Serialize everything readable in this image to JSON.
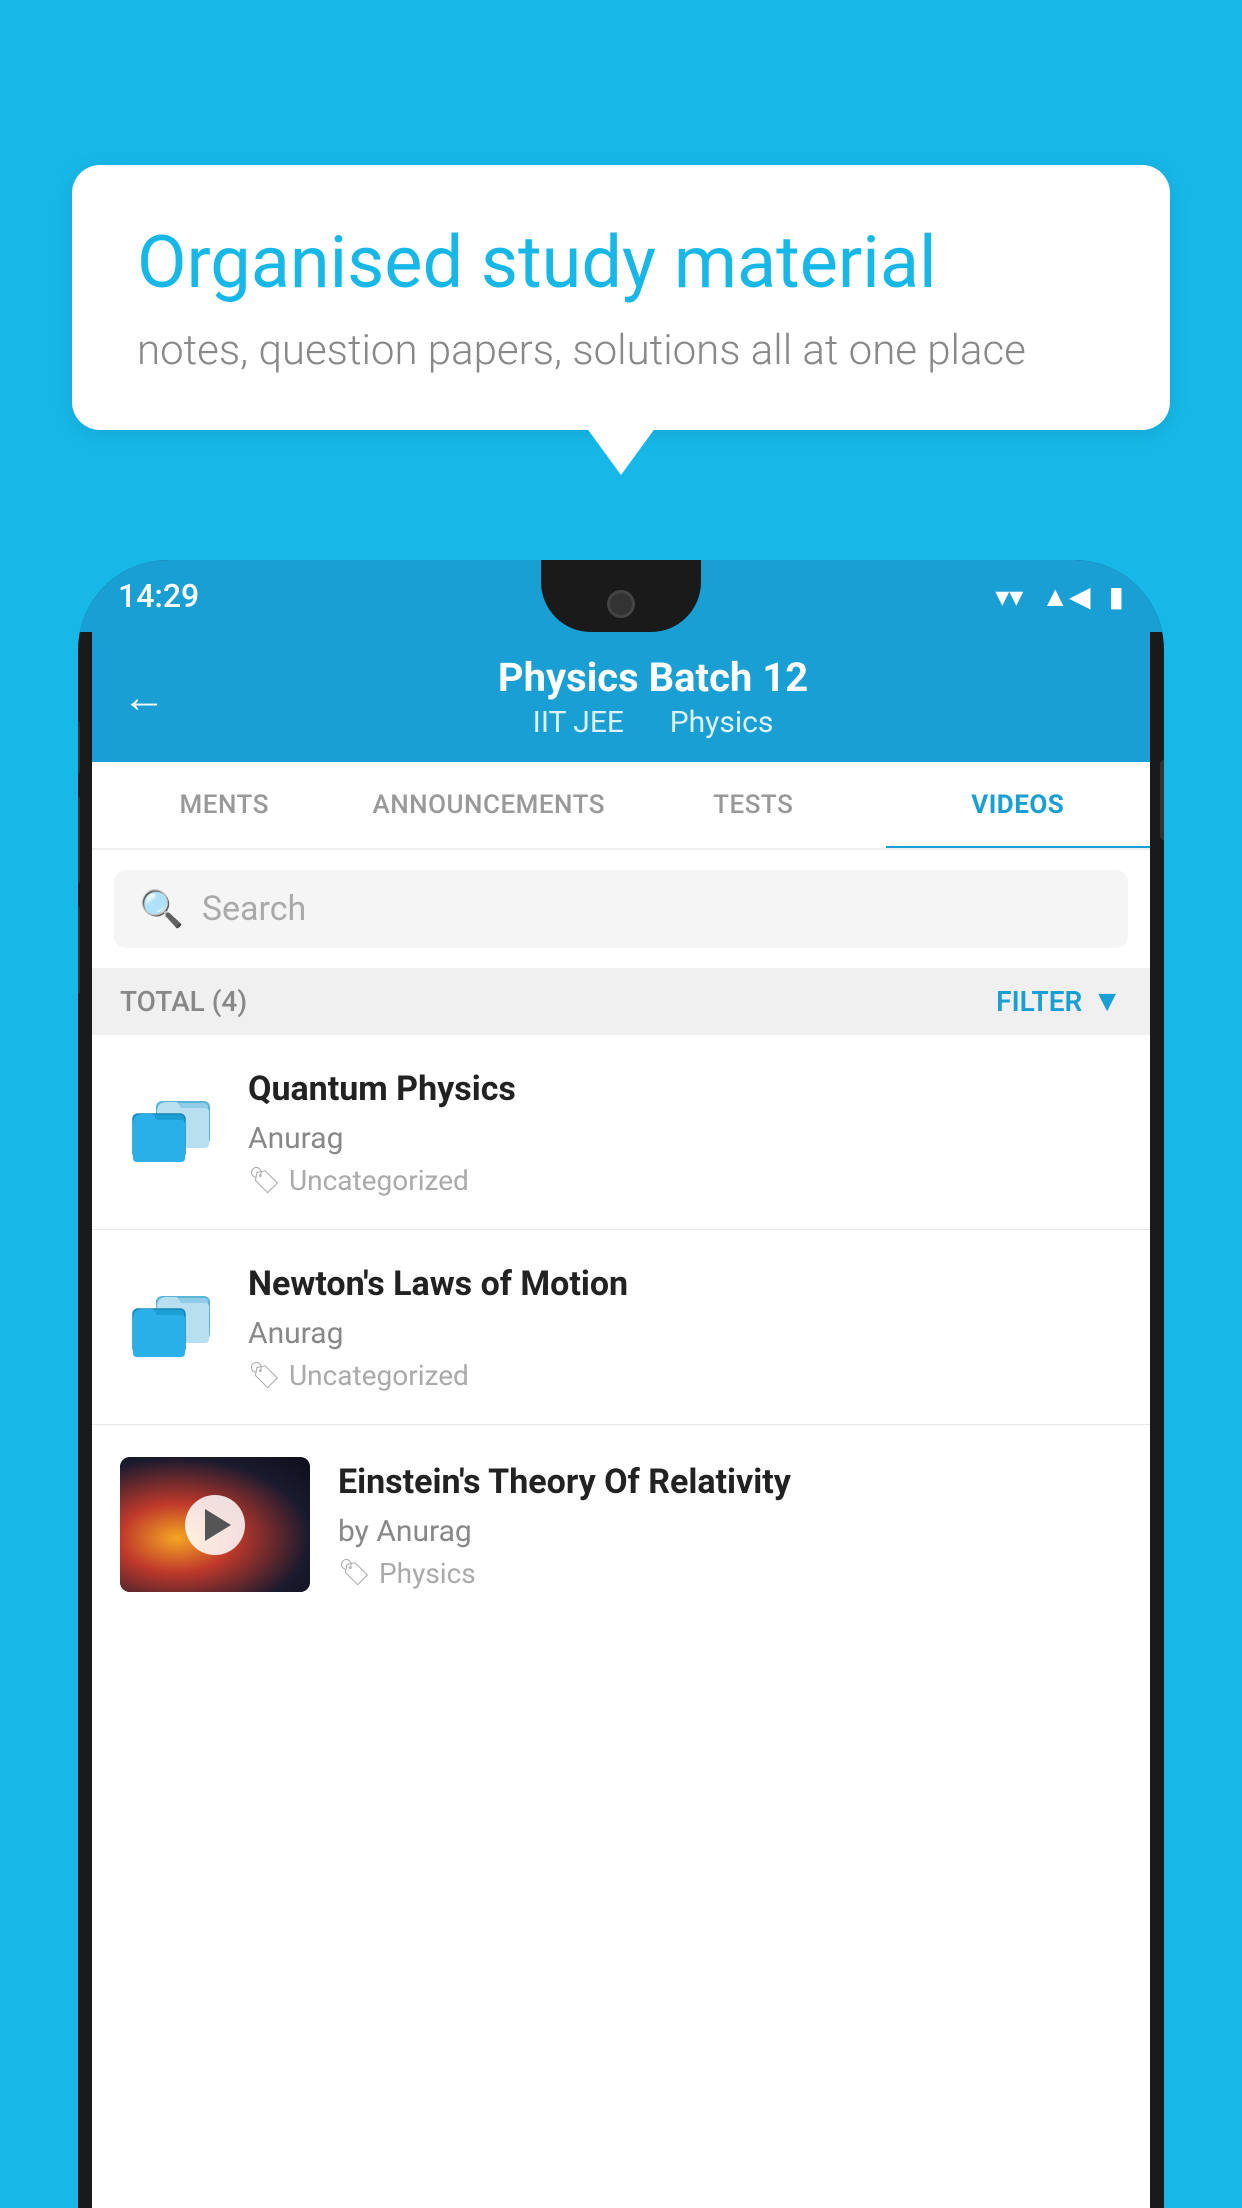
{
  "background_color": "#17b8e8",
  "bubble": {
    "title": "Organised study material",
    "subtitle": "notes, question papers, solutions all at one place"
  },
  "phone": {
    "status_bar": {
      "time": "14:29",
      "wifi_icon": "▼",
      "signal_icon": "▲",
      "battery_icon": "▮"
    },
    "header": {
      "title": "Physics Batch 12",
      "subtitle_left": "IIT JEE",
      "subtitle_right": "Physics",
      "back_label": "←"
    },
    "tabs": [
      {
        "label": "MENTS",
        "active": false
      },
      {
        "label": "ANNOUNCEMENTS",
        "active": false
      },
      {
        "label": "TESTS",
        "active": false
      },
      {
        "label": "VIDEOS",
        "active": true
      }
    ],
    "search": {
      "placeholder": "Search"
    },
    "filter": {
      "total_label": "TOTAL (4)",
      "filter_label": "FILTER"
    },
    "videos": [
      {
        "id": 1,
        "title": "Quantum Physics",
        "author": "Anurag",
        "tag": "Uncategorized",
        "type": "folder",
        "has_thumb": false
      },
      {
        "id": 2,
        "title": "Newton's Laws of Motion",
        "author": "Anurag",
        "tag": "Uncategorized",
        "type": "folder",
        "has_thumb": false
      },
      {
        "id": 3,
        "title": "Einstein's Theory Of Relativity",
        "author": "by Anurag",
        "tag": "Physics",
        "type": "video",
        "has_thumb": true
      }
    ]
  }
}
